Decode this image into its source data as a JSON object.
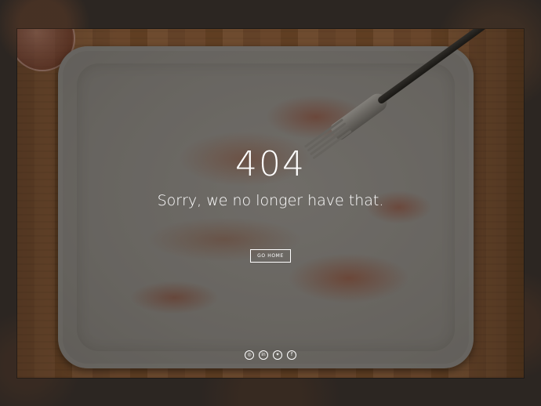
{
  "error": {
    "code": "404",
    "message": "Sorry, we no longer have that."
  },
  "actions": {
    "home_label": "GO HOME"
  },
  "social": [
    {
      "name": "instagram",
      "glyph": "◎"
    },
    {
      "name": "linkedin",
      "glyph": "in"
    },
    {
      "name": "twitter",
      "glyph": "✦"
    },
    {
      "name": "facebook",
      "glyph": "f"
    }
  ],
  "colors": {
    "text": "#ffffff",
    "background": "#2c2622"
  }
}
